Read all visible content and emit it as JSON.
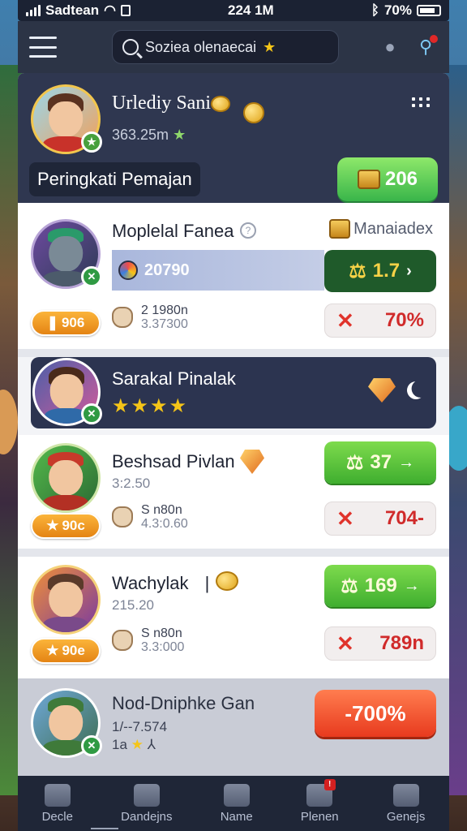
{
  "status_bar": {
    "carrier": "Sadtean",
    "time": "224 1M",
    "battery": "70%"
  },
  "app_bar": {
    "search_text": "Soziea olenaecai"
  },
  "profile": {
    "name": "Urlediy Sani",
    "score": "363.25m",
    "rank_label": "Peringkati Pemajan",
    "points": "206"
  },
  "players": [
    {
      "name": "Moplelal Fanea",
      "tag": "Manaiadex",
      "highlight_value": "20790",
      "action_value": "1.7",
      "badge": "906",
      "stat_line1": "2 1980n",
      "stat_line2": "3.37300",
      "loss_value": "70%"
    },
    {
      "name": "Sarakal Pinalak",
      "stars": "★★★★"
    },
    {
      "name": "Beshsad Pivlan",
      "sub": "3:2.50",
      "action_value": "37",
      "badge": "90c",
      "stat_line1": "S n80n",
      "stat_line2": "4.3:0.60",
      "loss_value": "704-"
    },
    {
      "name": "Wachylak",
      "sub": "215.20",
      "action_value": "169",
      "badge": "90e",
      "stat_line1": "S n80n",
      "stat_line2": "3.3:000",
      "loss_value": "789n"
    },
    {
      "name": "Nod-Dniphke Gan",
      "sub1": "1/--7.574",
      "sub2": "1a",
      "action_value": "-700%"
    }
  ],
  "nav": {
    "items": [
      "Decle",
      "Dandejns",
      "Name",
      "Plenen",
      "Genejs"
    ]
  },
  "colors": {
    "accent_green": "#3fae2f",
    "accent_orange": "#e83a1e",
    "header_navy": "#2f3750"
  }
}
